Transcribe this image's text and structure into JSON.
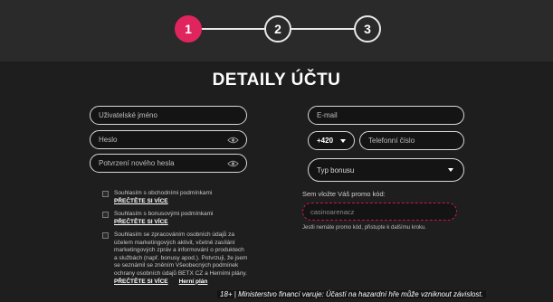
{
  "stepper": {
    "steps": [
      {
        "label": "1",
        "active": true
      },
      {
        "label": "2",
        "active": false
      },
      {
        "label": "3",
        "active": false
      }
    ],
    "active_color": "#e0245e"
  },
  "main": {
    "title": "DETAILY ÚČTU"
  },
  "form": {
    "username_placeholder": "Uživatelské jméno",
    "password_placeholder": "Heslo",
    "password_confirm_placeholder": "Potvrzení nového hesla",
    "email_placeholder": "E-mail",
    "phone_prefix": "+420",
    "phone_placeholder": "Telefonní číslo",
    "bonus_type_placeholder": "Typ bonusu",
    "promo_label": "Sem vložte Váš promo kód:",
    "promo_value": "casinoarenacz",
    "promo_note": "Jestli nemáte promo kód, přistupte k dalšímu kroku."
  },
  "consents": {
    "terms_text": "Souhlasím s obchodními podmínkami",
    "terms_link": "PŘEČTĚTE SI VÍCE",
    "bonus_text": "Souhlasím s bonusovými podmínkami",
    "bonus_link": "PŘEČTĚTE SI VÍCE",
    "marketing_lines": [
      "Souhlasím se zpracováním osobních údajů za",
      "účelem marketingových aktivit, včetně zasílání",
      "marketingových zpráv a informování o produktech",
      "a službách (např. bonusy apod.). Potvrzuji, že jsem",
      "se seznámil se zněním Všeobecných podmínek",
      "ochrany osobních údajů BETX CZ a Herními plány."
    ],
    "marketing_link": "PŘEČTĚTE SI VÍCE",
    "game_plan_link": "Herní plán"
  },
  "footer": {
    "disclaimer": "18+ | Ministerstvo financí varuje: Účastí na hazardní hře může vzniknout závislost."
  },
  "icons": {
    "eye": "eye-icon",
    "caret": "chevron-down-icon"
  }
}
